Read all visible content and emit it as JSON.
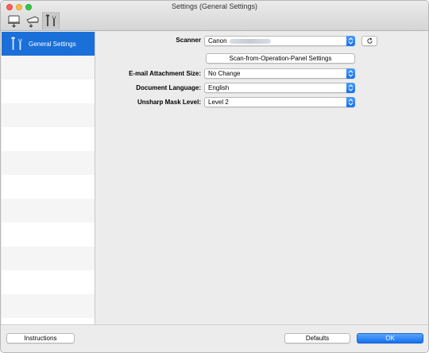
{
  "window": {
    "title": "Settings (General Settings)"
  },
  "toolbar": {
    "items": [
      {
        "name": "scan-from-computer",
        "icon": "computer-scan-icon",
        "selected": false
      },
      {
        "name": "scan-from-panel",
        "icon": "scanner-panel-icon",
        "selected": false
      },
      {
        "name": "general-settings",
        "icon": "tools-icon",
        "selected": true
      }
    ]
  },
  "sidebar": {
    "items": [
      {
        "label": "General Settings",
        "icon": "tools-icon",
        "selected": true
      }
    ]
  },
  "form": {
    "scanner_label": "Scanner",
    "scanner_value": "Canon",
    "scan_panel_button": "Scan-from-Operation-Panel Settings",
    "email_label": "E-mail Attachment Size:",
    "email_value": "No Change",
    "language_label": "Document Language:",
    "language_value": "English",
    "unsharp_label": "Unsharp Mask Level:",
    "unsharp_value": "Level 2"
  },
  "footer": {
    "instructions_label": "Instructions",
    "defaults_label": "Defaults",
    "ok_label": "OK"
  },
  "colors": {
    "accent": "#1a6fd8",
    "popup_arrow": "#1670ee"
  }
}
